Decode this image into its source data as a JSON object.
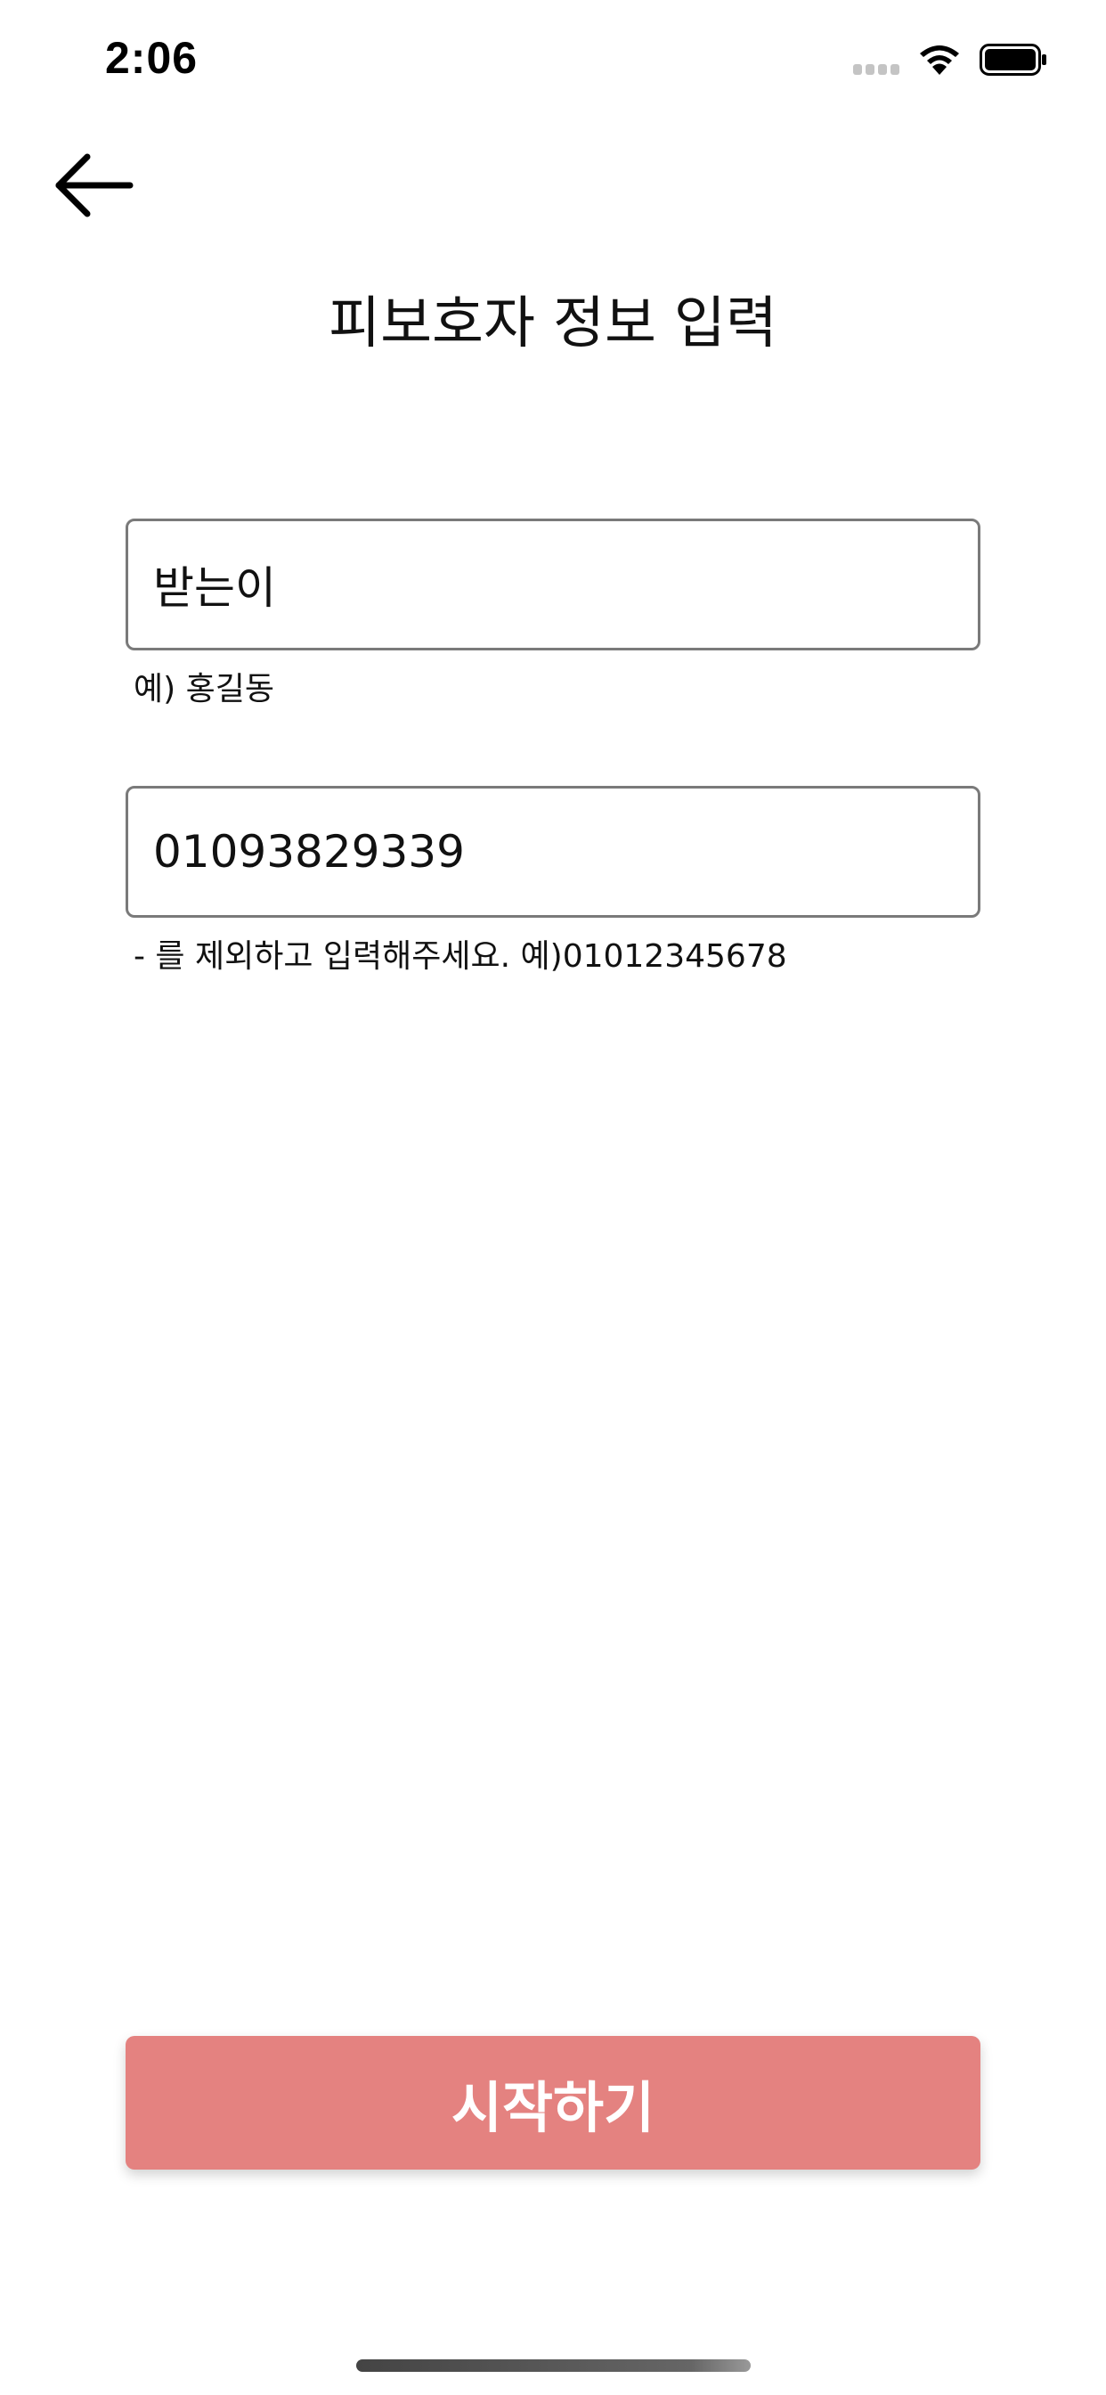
{
  "status_bar": {
    "time": "2:06"
  },
  "header": {
    "back_icon": "arrow-left-icon",
    "title": "피보호자 정보 입력"
  },
  "form": {
    "name": {
      "value": "받는이",
      "hint": "예) 홍길동"
    },
    "phone": {
      "value": "01093829339",
      "hint": "- 를 제외하고 입력해주세요. 예)01012345678"
    }
  },
  "actions": {
    "start_label": "시작하기"
  },
  "colors": {
    "button": "#e48280",
    "field_border": "#7a7a7a"
  }
}
